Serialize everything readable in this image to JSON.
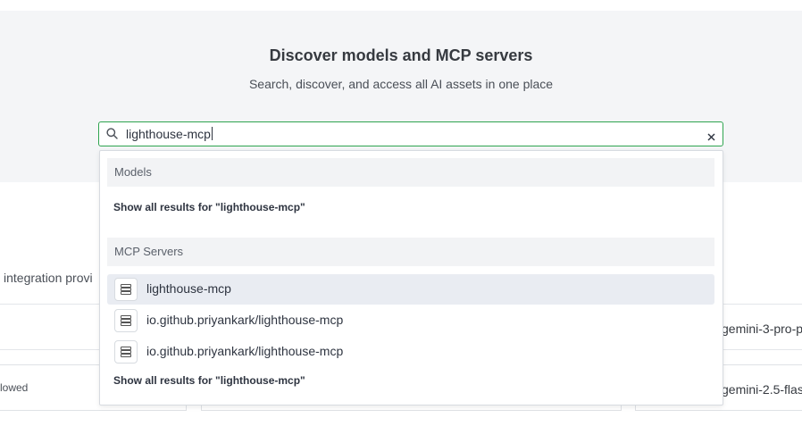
{
  "hero": {
    "title": "Discover models and MCP servers",
    "subtitle": "Search, discover, and access all AI assets in one place"
  },
  "search": {
    "value": "lighthouse-mcp",
    "icon": "search-icon",
    "clear_icon": "close-icon",
    "accent_color": "#2ea44f"
  },
  "background": {
    "left_label": "integration provi",
    "allowed_text": "lowed",
    "right_items": [
      "gemini-3-pro-p",
      "gemini-2.5-flas"
    ]
  },
  "dropdown": {
    "models": {
      "heading": "Models",
      "show_all": "Show all results for \"lighthouse-mcp\""
    },
    "mcp_servers": {
      "heading": "MCP Servers",
      "results": [
        {
          "label": "lighthouse-mcp",
          "icon": "server-icon",
          "active": true
        },
        {
          "label": "io.github.priyankark/lighthouse-mcp",
          "icon": "server-icon",
          "active": false
        },
        {
          "label": "io.github.priyankark/lighthouse-mcp",
          "icon": "server-icon",
          "active": false
        }
      ],
      "show_all": "Show all results for \"lighthouse-mcp\""
    }
  }
}
